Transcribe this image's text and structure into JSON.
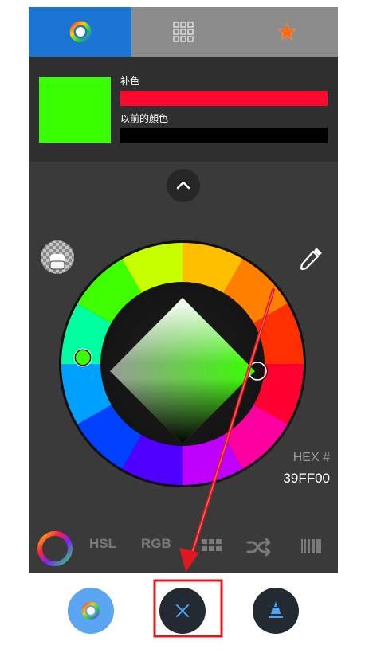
{
  "tabs": [
    {
      "name": "color-wheel-tab",
      "icon": "color-wheel-icon",
      "active": true
    },
    {
      "name": "palette-grid-tab",
      "icon": "grid-icon",
      "active": false
    },
    {
      "name": "favorites-tab",
      "icon": "star-icon",
      "active": false
    }
  ],
  "swatches": {
    "current_color": "#39FF00",
    "complement_label": "补色",
    "complement_color": "#FF0A2E",
    "previous_label": "以前的顏色",
    "previous_color": "#000000"
  },
  "hex": {
    "label": "HEX #",
    "value": "39FF00"
  },
  "modes": {
    "hsl": "HSL",
    "rgb": "RGB"
  },
  "colors": {
    "accent": "#1a74d4",
    "annotation": "#e0171e"
  },
  "icons": [
    "color-wheel-icon",
    "grid-icon",
    "star-icon",
    "chevron-up-icon",
    "alpha-icon",
    "eyedropper-icon",
    "swatches-icon",
    "shuffle-icon",
    "gradient-icon",
    "close-icon",
    "brush-icon"
  ]
}
